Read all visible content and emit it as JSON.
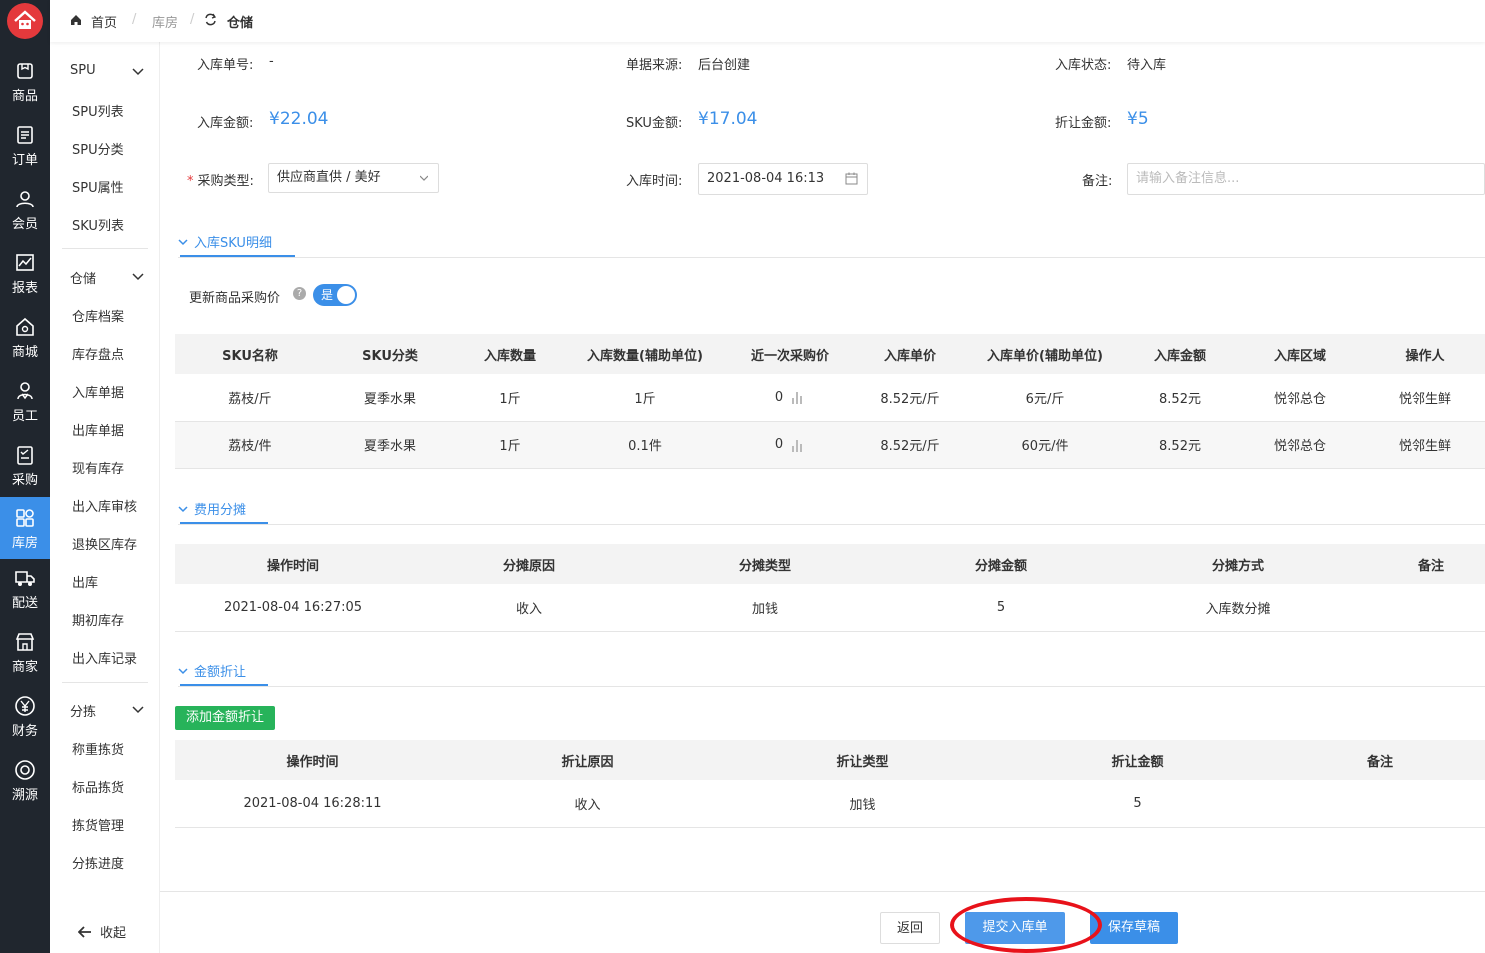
{
  "nav": {
    "items": [
      {
        "label": "商品",
        "icon": "product-icon"
      },
      {
        "label": "订单",
        "icon": "order-icon"
      },
      {
        "label": "会员",
        "icon": "member-icon"
      },
      {
        "label": "报表",
        "icon": "report-icon"
      },
      {
        "label": "商城",
        "icon": "mall-icon"
      },
      {
        "label": "员工",
        "icon": "staff-icon"
      },
      {
        "label": "采购",
        "icon": "purchase-icon"
      },
      {
        "label": "库房",
        "icon": "warehouse-icon"
      },
      {
        "label": "配送",
        "icon": "delivery-icon"
      },
      {
        "label": "商家",
        "icon": "merchant-icon"
      },
      {
        "label": "财务",
        "icon": "finance-icon"
      },
      {
        "label": "溯源",
        "icon": "trace-icon"
      }
    ],
    "active": "库房"
  },
  "subnav": {
    "groups": [
      {
        "label": "SPU",
        "items": [
          "SPU列表",
          "SPU分类",
          "SPU属性",
          "SKU列表"
        ]
      },
      {
        "label": "仓储",
        "items": [
          "仓库档案",
          "库存盘点",
          "入库单据",
          "出库单据",
          "现有库存",
          "出入库审核",
          "退换区库存",
          "出库",
          "期初库存",
          "出入库记录"
        ]
      },
      {
        "label": "分拣",
        "items": [
          "称重拣货",
          "标品拣货",
          "拣货管理",
          "分拣进度"
        ]
      }
    ],
    "collapse": "收起"
  },
  "breadcrumb": {
    "home": "首页",
    "section": "库房",
    "current": "仓储"
  },
  "form": {
    "order_no_label": "入库单号:",
    "order_no": "-",
    "source_label": "单据来源:",
    "source": "后台创建",
    "status_label": "入库状态:",
    "status": "待入库",
    "amount_label": "入库金额:",
    "amount": "¥22.04",
    "sku_amount_label": "SKU金额:",
    "sku_amount": "¥17.04",
    "discount_label": "折让金额:",
    "discount": "¥5",
    "purchase_type_label": "采购类型:",
    "purchase_type": "供应商直供 / 美好",
    "time_label": "入库时间:",
    "time": "2021-08-04 16:13",
    "remark_label": "备注:",
    "remark_placeholder": "请输入备注信息..."
  },
  "sku_section": {
    "title": "入库SKU明细",
    "update_price_label": "更新商品采购价",
    "toggle_text": "是",
    "headers": [
      "SKU名称",
      "SKU分类",
      "入库数量",
      "入库数量(辅助单位)",
      "近一次采购价",
      "入库单价",
      "入库单价(辅助单位)",
      "入库金额",
      "入库区域",
      "操作人"
    ],
    "rows": [
      [
        "荔枝/斤",
        "夏季水果",
        "1斤",
        "1斤",
        "0",
        "8.52元/斤",
        "6元/斤",
        "8.52元",
        "悦邻总仓",
        "悦邻生鲜"
      ],
      [
        "荔枝/件",
        "夏季水果",
        "1斤",
        "0.1件",
        "0",
        "8.52元/斤",
        "60元/件",
        "8.52元",
        "悦邻总仓",
        "悦邻生鲜"
      ]
    ]
  },
  "cost_section": {
    "title": "费用分摊",
    "headers": [
      "操作时间",
      "分摊原因",
      "分摊类型",
      "分摊金额",
      "分摊方式",
      "备注"
    ],
    "rows": [
      [
        "2021-08-04 16:27:05",
        "收入",
        "加钱",
        "5",
        "入库数分摊",
        ""
      ]
    ]
  },
  "discount_section": {
    "title": "金额折让",
    "add_button": "添加金额折让",
    "headers": [
      "操作时间",
      "折让原因",
      "折让类型",
      "折让金额",
      "备注"
    ],
    "rows": [
      [
        "2021-08-04 16:28:11",
        "收入",
        "加钱",
        "5",
        ""
      ]
    ]
  },
  "footer": {
    "back": "返回",
    "submit": "提交入库单",
    "draft": "保存草稿"
  },
  "colors": {
    "accent": "#3b8fe8",
    "nav_bg": "#20262e",
    "green": "#27b35a",
    "highlight": "#e8121a"
  }
}
